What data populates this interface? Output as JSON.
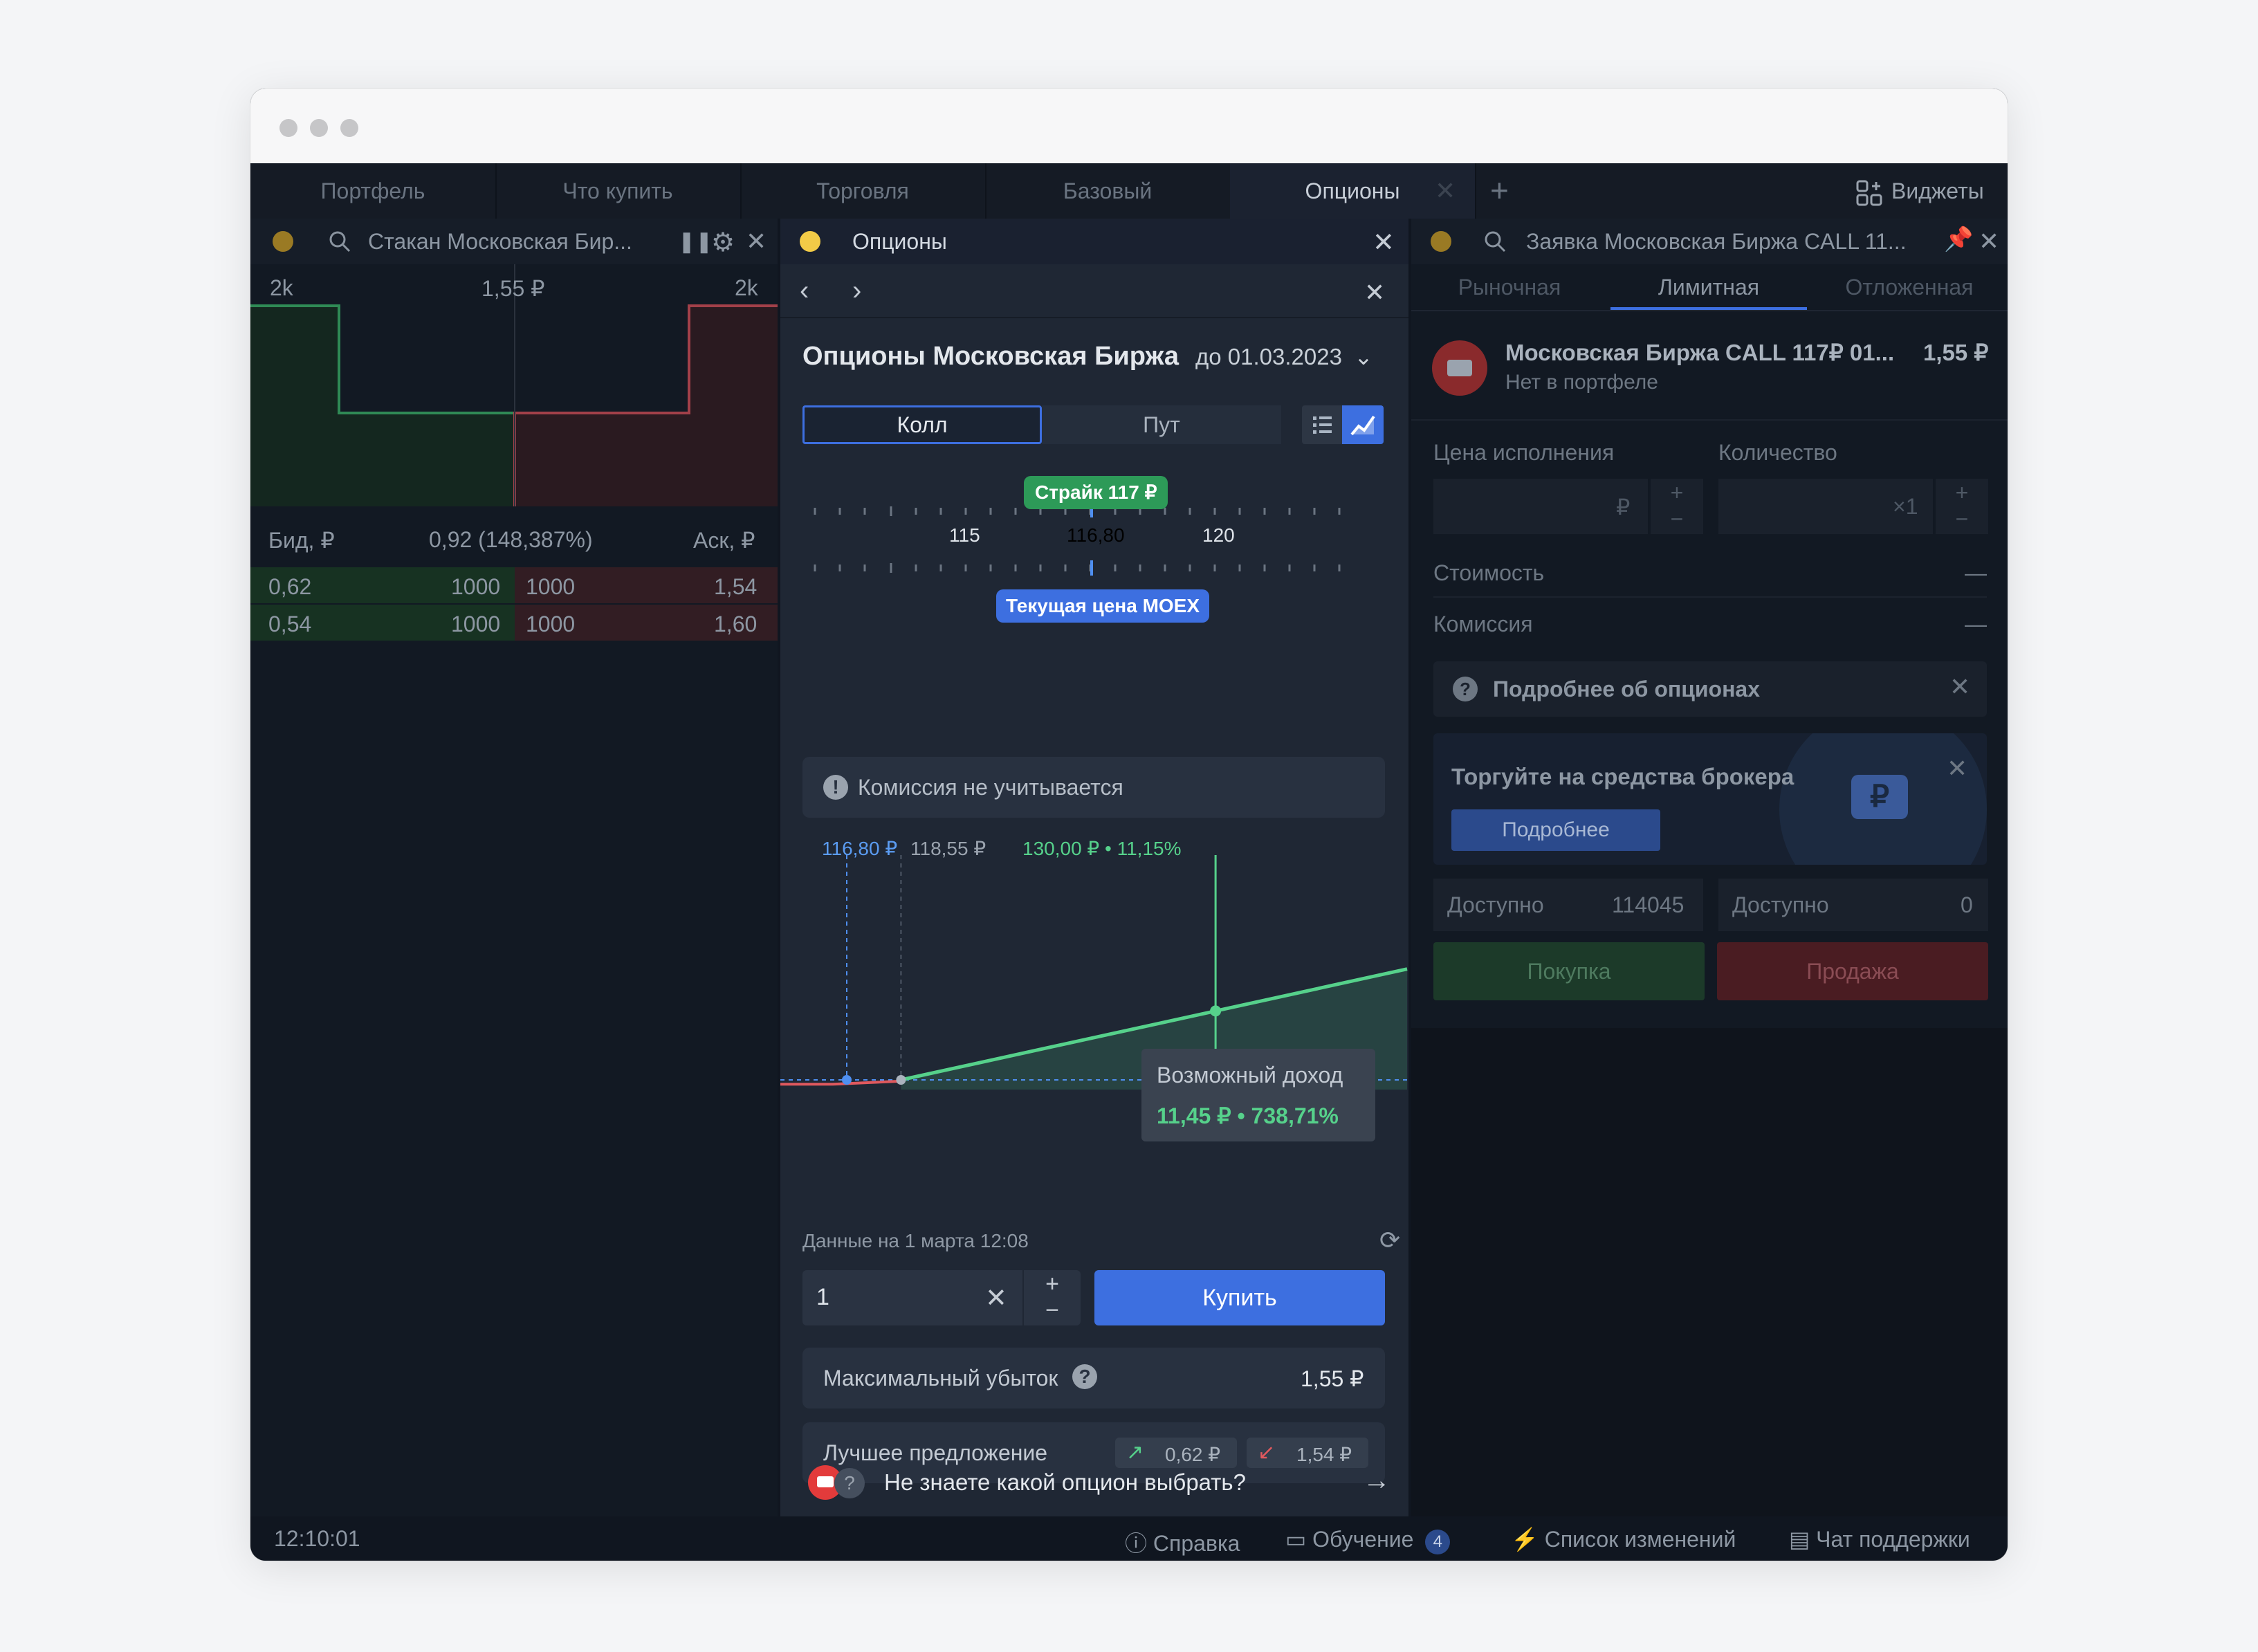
{
  "tabs": [
    "Портфель",
    "Что купить",
    "Торговля",
    "Базовый",
    "Опционы"
  ],
  "widgets_label": "Виджеты",
  "orderbook": {
    "title": "Стакан Московская Бир...",
    "depth_left": "2k",
    "price": "1,55 ₽",
    "depth_right": "2k",
    "bid_header": "Бид, ₽",
    "spread": "0,92 (148,387%)",
    "ask_header": "Аск, ₽",
    "rows": [
      {
        "bid": "0,62",
        "bid_qty": "1000",
        "ask_qty": "1000",
        "ask": "1,54"
      },
      {
        "bid": "0,54",
        "bid_qty": "1000",
        "ask_qty": "1000",
        "ask": "1,60"
      }
    ]
  },
  "options": {
    "panel_title": "Опционы",
    "heading": "Опционы Московская Биржа",
    "expiry": "до 01.03.2023",
    "call_label": "Колл",
    "put_label": "Пут",
    "strike_badge": "Страйк 117 ₽",
    "scale_left": "115",
    "scale_current": "116,80",
    "scale_right": "120",
    "current_badge": "Текущая цена MOEX",
    "commission_note": "Комиссия не учитывается",
    "chart_label_current": "116,80 ₽",
    "chart_label_breakeven": "118,55 ₽",
    "chart_label_target": "130,00 ₽ • 11,15%",
    "tooltip_title": "Возможный доход",
    "tooltip_value": "11,45 ₽ • 738,71%",
    "data_time": "Данные на 1 марта 12:08",
    "quantity": "1",
    "buy_label": "Купить",
    "max_loss_label": "Максимальный убыток",
    "max_loss_value": "1,55 ₽",
    "best_offer_label": "Лучшее предложение",
    "best_bid": "0,62 ₽",
    "best_ask": "1,54 ₽",
    "helper_text": "Не знаете какой опцион выбрать?"
  },
  "order": {
    "title": "Заявка Московская Биржа CALL 11...",
    "tabs": [
      "Рыночная",
      "Лимитная",
      "Отложенная"
    ],
    "instrument": "Московская Биржа CALL 117₽ 01...",
    "instrument_price": "1,55 ₽",
    "portfolio_note": "Нет в портфеле",
    "price_label": "Цена исполнения",
    "price_unit": "₽",
    "qty_label": "Количество",
    "qty_unit": "×1",
    "cost_label": "Стоимость",
    "cost_value": "—",
    "commission_label": "Комиссия",
    "commission_value": "—",
    "info_label": "Подробнее об опционах",
    "promo_title": "Торгуйте на средства брокера",
    "promo_button": "Подробнее",
    "available_label_left": "Доступно",
    "available_value_left": "114045",
    "available_label_right": "Доступно",
    "available_value_right": "0",
    "buy_label": "Покупка",
    "sell_label": "Продажа"
  },
  "footer": {
    "time": "12:10:01",
    "help": "Справка",
    "learning": "Обучение",
    "learning_badge": "4",
    "changes": "Список изменений",
    "chat": "Чат поддержки"
  },
  "colors": {
    "accent": "#3d6fe0",
    "positive": "#56d18b",
    "negative": "#e0595e",
    "background": "#101620"
  },
  "chart_data": {
    "type": "line",
    "title": "",
    "xlabel": "",
    "ylabel": "",
    "x": [
      116.8,
      118.55,
      130.0
    ],
    "annotations": [
      "116,80 ₽",
      "118,55 ₽",
      "130,00 ₽ • 11,15%"
    ],
    "series": [
      {
        "values": [
          -1.55,
          0,
          11.45
        ]
      }
    ]
  }
}
